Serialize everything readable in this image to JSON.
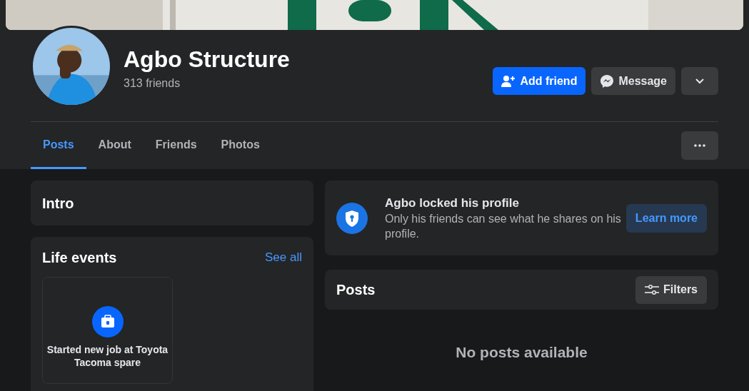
{
  "profile": {
    "name": "Agbo Structure",
    "friends": "313 friends"
  },
  "actions": [
    {
      "kind": "add",
      "label": "Add friend"
    },
    {
      "kind": "message",
      "label": "Message"
    },
    {
      "kind": "more"
    }
  ],
  "tabs": [
    {
      "label": "Posts",
      "selected": true
    },
    {
      "label": "About",
      "selected": false
    },
    {
      "label": "Friends",
      "selected": false
    },
    {
      "label": "Photos",
      "selected": false
    }
  ],
  "intro": {
    "title": "Intro"
  },
  "life_events": {
    "title": "Life events",
    "link": "See all",
    "events": [
      {
        "text": "Started new job at Toyota Tacoma spare"
      }
    ]
  },
  "locked_notice": {
    "title": "Agbo locked his profile",
    "text": "Only his friends can see what he shares on his profile.",
    "button": "Learn more"
  },
  "posts": {
    "title": "Posts",
    "filter": "Filters",
    "empty": "No posts available"
  }
}
